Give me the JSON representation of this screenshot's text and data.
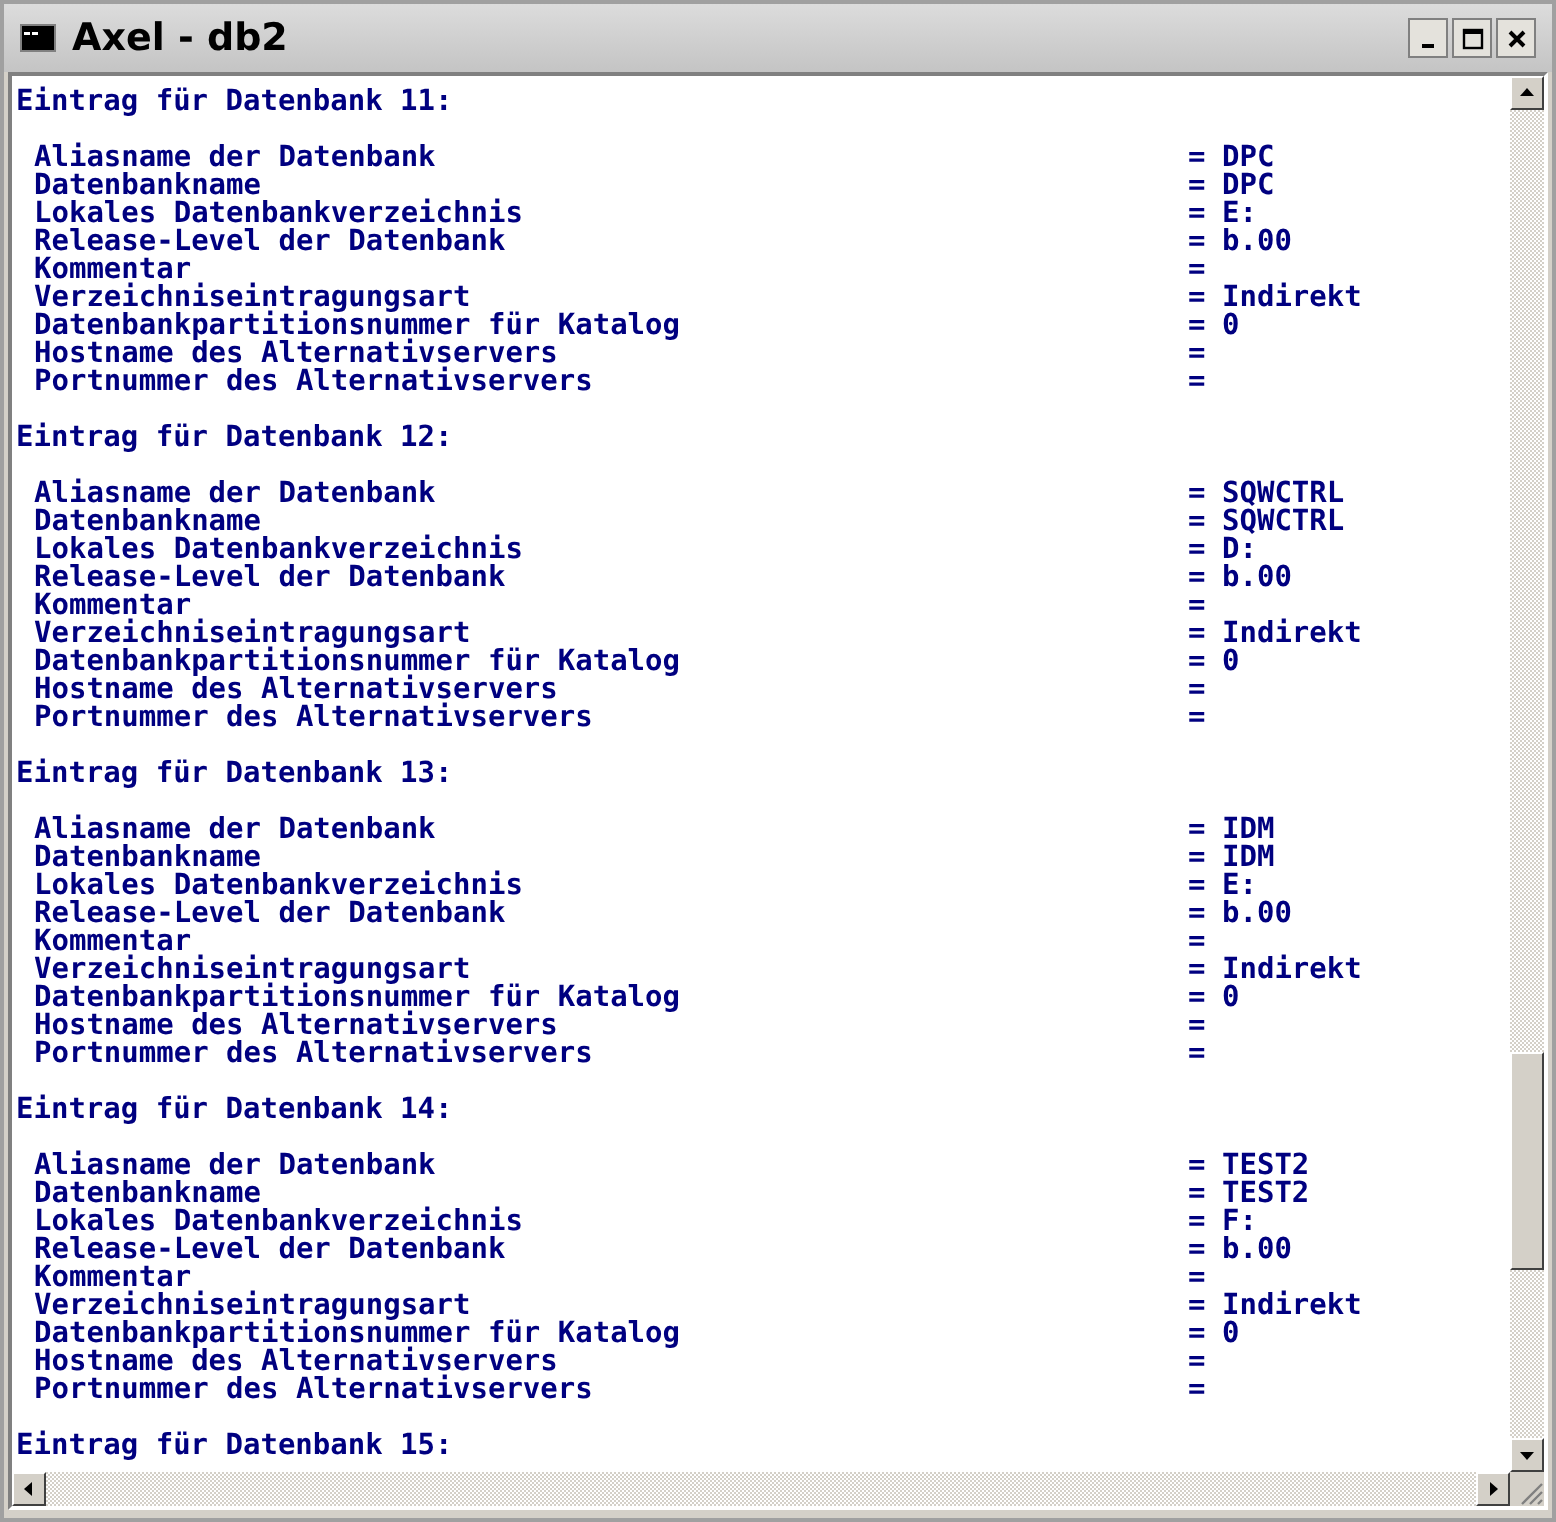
{
  "window": {
    "title": "Axel - db2"
  },
  "entries": [
    {
      "heading": "Eintrag für Datenbank 11:",
      "rows": [
        {
          "label": "Aliasname der Datenbank",
          "sep": "=",
          "value": "DPC"
        },
        {
          "label": "Datenbankname",
          "sep": "=",
          "value": "DPC"
        },
        {
          "label": "Lokales Datenbankverzeichnis",
          "sep": "=",
          "value": "E:"
        },
        {
          "label": "Release-Level der Datenbank",
          "sep": "=",
          "value": "b.00"
        },
        {
          "label": "Kommentar",
          "sep": "="
        },
        {
          "label": "Verzeichniseintragungsart",
          "sep": "=",
          "value": "Indirekt"
        },
        {
          "label": "Datenbankpartitionsnummer für Katalog",
          "sep": "=",
          "value": "0"
        },
        {
          "label": "Hostname des Alternativservers",
          "sep": "="
        },
        {
          "label": "Portnummer des Alternativservers",
          "sep": "="
        }
      ]
    },
    {
      "heading": "Eintrag für Datenbank 12:",
      "rows": [
        {
          "label": "Aliasname der Datenbank",
          "sep": "=",
          "value": "SQWCTRL"
        },
        {
          "label": "Datenbankname",
          "sep": "=",
          "value": "SQWCTRL"
        },
        {
          "label": "Lokales Datenbankverzeichnis",
          "sep": "=",
          "value": "D:"
        },
        {
          "label": "Release-Level der Datenbank",
          "sep": "=",
          "value": "b.00"
        },
        {
          "label": "Kommentar",
          "sep": "="
        },
        {
          "label": "Verzeichniseintragungsart",
          "sep": "=",
          "value": "Indirekt"
        },
        {
          "label": "Datenbankpartitionsnummer für Katalog",
          "sep": "=",
          "value": "0"
        },
        {
          "label": "Hostname des Alternativservers",
          "sep": "="
        },
        {
          "label": "Portnummer des Alternativservers",
          "sep": "="
        }
      ]
    },
    {
      "heading": "Eintrag für Datenbank 13:",
      "rows": [
        {
          "label": "Aliasname der Datenbank",
          "sep": "=",
          "value": "IDM"
        },
        {
          "label": "Datenbankname",
          "sep": "=",
          "value": "IDM"
        },
        {
          "label": "Lokales Datenbankverzeichnis",
          "sep": "=",
          "value": "E:"
        },
        {
          "label": "Release-Level der Datenbank",
          "sep": "=",
          "value": "b.00"
        },
        {
          "label": "Kommentar",
          "sep": "="
        },
        {
          "label": "Verzeichniseintragungsart",
          "sep": "=",
          "value": "Indirekt"
        },
        {
          "label": "Datenbankpartitionsnummer für Katalog",
          "sep": "=",
          "value": "0"
        },
        {
          "label": "Hostname des Alternativservers",
          "sep": "="
        },
        {
          "label": "Portnummer des Alternativservers",
          "sep": "="
        }
      ]
    },
    {
      "heading": "Eintrag für Datenbank 14:",
      "rows": [
        {
          "label": "Aliasname der Datenbank",
          "sep": "=",
          "value": "TEST2"
        },
        {
          "label": "Datenbankname",
          "sep": "=",
          "value": "TEST2"
        },
        {
          "label": "Lokales Datenbankverzeichnis",
          "sep": "=",
          "value": "F:"
        },
        {
          "label": "Release-Level der Datenbank",
          "sep": "=",
          "value": "b.00"
        },
        {
          "label": "Kommentar",
          "sep": "="
        },
        {
          "label": "Verzeichniseintragungsart",
          "sep": "=",
          "value": "Indirekt"
        },
        {
          "label": "Datenbankpartitionsnummer für Katalog",
          "sep": "=",
          "value": "0"
        },
        {
          "label": "Hostname des Alternativservers",
          "sep": "="
        },
        {
          "label": "Portnummer des Alternativservers",
          "sep": "="
        }
      ]
    },
    {
      "heading": "Eintrag für Datenbank 15:"
    }
  ]
}
